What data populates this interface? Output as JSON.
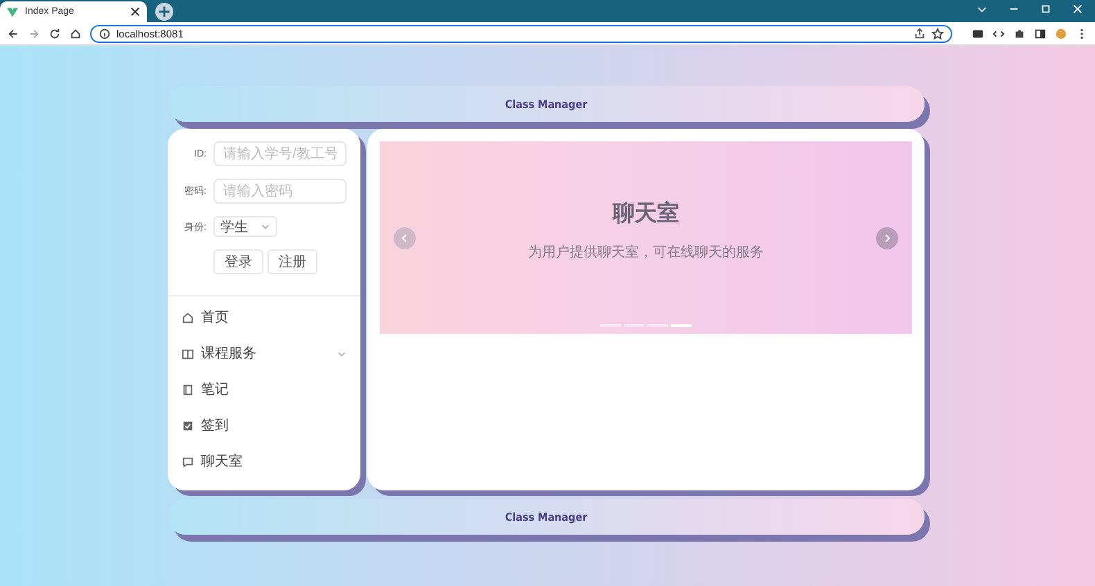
{
  "browser": {
    "tab_title": "Index Page",
    "address": "localhost:8081"
  },
  "header": {
    "title": "Class Manager"
  },
  "login": {
    "fields": [
      {
        "label": "ID:",
        "placeholder": "请输入学号/教工号"
      },
      {
        "label": "密码:",
        "placeholder": "请输入密码"
      }
    ],
    "role": {
      "label": "身份:",
      "value": "学生"
    },
    "buttons": [
      "登录",
      "注册"
    ]
  },
  "menu": [
    {
      "label": "首页",
      "kind": "item"
    },
    {
      "label": "课程服务",
      "kind": "submenu",
      "expanded": false
    },
    {
      "label": "笔记",
      "kind": "item"
    },
    {
      "label": "签到",
      "kind": "item"
    },
    {
      "label": "聊天室",
      "kind": "item"
    }
  ],
  "carousel": {
    "title": "聊天室",
    "subtitle": "为用户提供聊天室，可在线聊天的服务",
    "indicators": [
      {
        "selected": false
      },
      {
        "selected": false
      },
      {
        "selected": false
      },
      {
        "selected": true
      }
    ]
  },
  "footer": {
    "title": "Class Manager"
  }
}
